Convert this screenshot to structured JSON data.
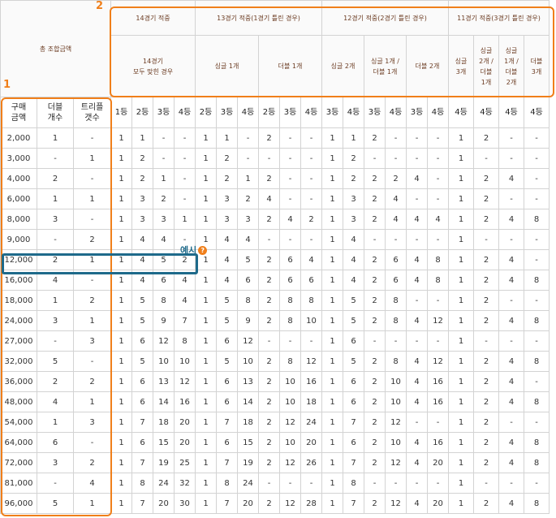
{
  "badges": {
    "purchase": "1",
    "match": "2"
  },
  "example": {
    "label": "예시",
    "icon": "help-icon"
  },
  "header": {
    "total_label": "총 조합금액",
    "groups": [
      {
        "title": "14경기 적중",
        "subs": [
          "14경기\n모두 맞힌 경우"
        ]
      },
      {
        "title": "13경기 적중(1경기 틀린 경우)",
        "subs": [
          "싱글 1개",
          "더블 1개"
        ]
      },
      {
        "title": "12경기 적중(2경기 틀린 경우)",
        "subs": [
          "싱글 2개",
          "싱글 1개 /\n더블 1개",
          "더블 2개"
        ]
      },
      {
        "title": "11경기 적중(3경기 틀린 경우)",
        "subs": [
          "싱글\n3개",
          "싱글\n2개 /\n더블\n1개",
          "싱글\n1개 /\n더블\n2개",
          "더블\n3개"
        ]
      }
    ],
    "left_cols": [
      "구매\n금액",
      "더블\n개수",
      "트리플\n갯수"
    ],
    "ranks": [
      "1등",
      "2등",
      "3등",
      "4등",
      "2등",
      "3등",
      "4등",
      "2등",
      "3등",
      "4등",
      "3등",
      "4등",
      "3등",
      "4등",
      "3등",
      "4등",
      "4등",
      "4등",
      "4등",
      "4등"
    ]
  },
  "rows": [
    [
      "2,000",
      "1",
      "-",
      "1",
      "1",
      "-",
      "-",
      "1",
      "1",
      "-",
      "2",
      "-",
      "-",
      "1",
      "1",
      "2",
      "-",
      "-",
      "-",
      "1",
      "2",
      "-",
      "-"
    ],
    [
      "3,000",
      "-",
      "1",
      "1",
      "2",
      "-",
      "-",
      "1",
      "2",
      "-",
      "-",
      "-",
      "-",
      "1",
      "2",
      "-",
      "-",
      "-",
      "-",
      "1",
      "-",
      "-",
      "-"
    ],
    [
      "4,000",
      "2",
      "-",
      "1",
      "2",
      "1",
      "-",
      "1",
      "2",
      "1",
      "2",
      "-",
      "-",
      "1",
      "2",
      "2",
      "2",
      "4",
      "-",
      "1",
      "2",
      "4",
      "-"
    ],
    [
      "6,000",
      "1",
      "1",
      "1",
      "3",
      "2",
      "-",
      "1",
      "3",
      "2",
      "4",
      "-",
      "-",
      "1",
      "3",
      "2",
      "4",
      "-",
      "-",
      "1",
      "2",
      "-",
      "-"
    ],
    [
      "8,000",
      "3",
      "-",
      "1",
      "3",
      "3",
      "1",
      "1",
      "3",
      "3",
      "2",
      "4",
      "2",
      "1",
      "3",
      "2",
      "4",
      "4",
      "4",
      "1",
      "2",
      "4",
      "8"
    ],
    [
      "9,000",
      "-",
      "2",
      "1",
      "4",
      "4",
      "-",
      "1",
      "4",
      "4",
      "-",
      "-",
      "-",
      "1",
      "4",
      "-",
      "-",
      "-",
      "-",
      "1",
      "-",
      "-",
      "-"
    ],
    [
      "12,000",
      "2",
      "1",
      "1",
      "4",
      "5",
      "2",
      "1",
      "4",
      "5",
      "2",
      "6",
      "4",
      "1",
      "4",
      "2",
      "6",
      "4",
      "8",
      "1",
      "2",
      "4",
      "-"
    ],
    [
      "16,000",
      "4",
      "-",
      "1",
      "4",
      "6",
      "4",
      "1",
      "4",
      "6",
      "2",
      "6",
      "6",
      "1",
      "4",
      "2",
      "6",
      "4",
      "8",
      "1",
      "2",
      "4",
      "8"
    ],
    [
      "18,000",
      "1",
      "2",
      "1",
      "5",
      "8",
      "4",
      "1",
      "5",
      "8",
      "2",
      "8",
      "8",
      "1",
      "5",
      "2",
      "8",
      "-",
      "-",
      "1",
      "2",
      "-",
      "-"
    ],
    [
      "24,000",
      "3",
      "1",
      "1",
      "5",
      "9",
      "7",
      "1",
      "5",
      "9",
      "2",
      "8",
      "10",
      "1",
      "5",
      "2",
      "8",
      "4",
      "12",
      "1",
      "2",
      "4",
      "8"
    ],
    [
      "27,000",
      "-",
      "3",
      "1",
      "6",
      "12",
      "8",
      "1",
      "6",
      "12",
      "-",
      "-",
      "-",
      "1",
      "6",
      "-",
      "-",
      "-",
      "-",
      "1",
      "-",
      "-",
      "-"
    ],
    [
      "32,000",
      "5",
      "-",
      "1",
      "5",
      "10",
      "10",
      "1",
      "5",
      "10",
      "2",
      "8",
      "12",
      "1",
      "5",
      "2",
      "8",
      "4",
      "12",
      "1",
      "2",
      "4",
      "8"
    ],
    [
      "36,000",
      "2",
      "2",
      "1",
      "6",
      "13",
      "12",
      "1",
      "6",
      "13",
      "2",
      "10",
      "16",
      "1",
      "6",
      "2",
      "10",
      "4",
      "16",
      "1",
      "2",
      "4",
      "-"
    ],
    [
      "48,000",
      "4",
      "1",
      "1",
      "6",
      "14",
      "16",
      "1",
      "6",
      "14",
      "2",
      "10",
      "18",
      "1",
      "6",
      "2",
      "10",
      "4",
      "16",
      "1",
      "2",
      "4",
      "8"
    ],
    [
      "54,000",
      "1",
      "3",
      "1",
      "7",
      "18",
      "20",
      "1",
      "7",
      "18",
      "2",
      "12",
      "24",
      "1",
      "7",
      "2",
      "12",
      "-",
      "-",
      "1",
      "2",
      "-",
      "-"
    ],
    [
      "64,000",
      "6",
      "-",
      "1",
      "6",
      "15",
      "20",
      "1",
      "6",
      "15",
      "2",
      "10",
      "20",
      "1",
      "6",
      "2",
      "10",
      "4",
      "16",
      "1",
      "2",
      "4",
      "8"
    ],
    [
      "72,000",
      "3",
      "2",
      "1",
      "7",
      "19",
      "25",
      "1",
      "7",
      "19",
      "2",
      "12",
      "26",
      "1",
      "7",
      "2",
      "12",
      "4",
      "20",
      "1",
      "2",
      "4",
      "8"
    ],
    [
      "81,000",
      "-",
      "4",
      "1",
      "8",
      "24",
      "32",
      "1",
      "8",
      "24",
      "-",
      "-",
      "-",
      "1",
      "8",
      "-",
      "-",
      "-",
      "-",
      "1",
      "-",
      "-",
      "-"
    ],
    [
      "96,000",
      "5",
      "1",
      "1",
      "7",
      "20",
      "30",
      "1",
      "7",
      "20",
      "2",
      "12",
      "28",
      "1",
      "7",
      "2",
      "12",
      "4",
      "20",
      "1",
      "2",
      "4",
      "8"
    ]
  ],
  "colors": {
    "accent": "#f07f1a",
    "highlight": "#1e6a8a",
    "header_text": "#6a3a20"
  }
}
